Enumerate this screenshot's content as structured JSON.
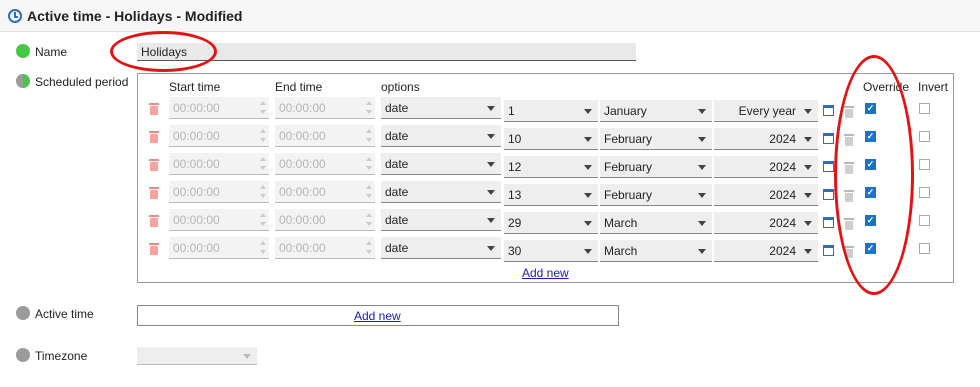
{
  "window": {
    "title": "Active time - Holidays - Modified"
  },
  "name_field": {
    "label": "Name",
    "value": "Holidays"
  },
  "scheduled": {
    "label": "Scheduled period",
    "headers": {
      "start": "Start time",
      "end": "End time",
      "options": "options",
      "override": "Override",
      "invert": "Invert"
    },
    "rows": [
      {
        "start": "00:00:00",
        "end": "00:00:00",
        "type": "date",
        "day": "1",
        "month": "January",
        "year": "Every year",
        "override": true,
        "invert": false
      },
      {
        "start": "00:00:00",
        "end": "00:00:00",
        "type": "date",
        "day": "10",
        "month": "February",
        "year": "2024",
        "override": true,
        "invert": false
      },
      {
        "start": "00:00:00",
        "end": "00:00:00",
        "type": "date",
        "day": "12",
        "month": "February",
        "year": "2024",
        "override": true,
        "invert": false
      },
      {
        "start": "00:00:00",
        "end": "00:00:00",
        "type": "date",
        "day": "13",
        "month": "February",
        "year": "2024",
        "override": true,
        "invert": false
      },
      {
        "start": "00:00:00",
        "end": "00:00:00",
        "type": "date",
        "day": "29",
        "month": "March",
        "year": "2024",
        "override": true,
        "invert": false
      },
      {
        "start": "00:00:00",
        "end": "00:00:00",
        "type": "date",
        "day": "30",
        "month": "March",
        "year": "2024",
        "override": true,
        "invert": false
      }
    ],
    "add_new": "Add new"
  },
  "active_time": {
    "label": "Active time",
    "add_new": "Add new"
  },
  "timezone": {
    "label": "Timezone",
    "value": ""
  },
  "colors": {
    "accent": "#2a6ebd",
    "status_green": "#45c746",
    "status_grey": "#9b9b9b",
    "annotation_red": "#e31313",
    "link": "#1a1ac8"
  }
}
